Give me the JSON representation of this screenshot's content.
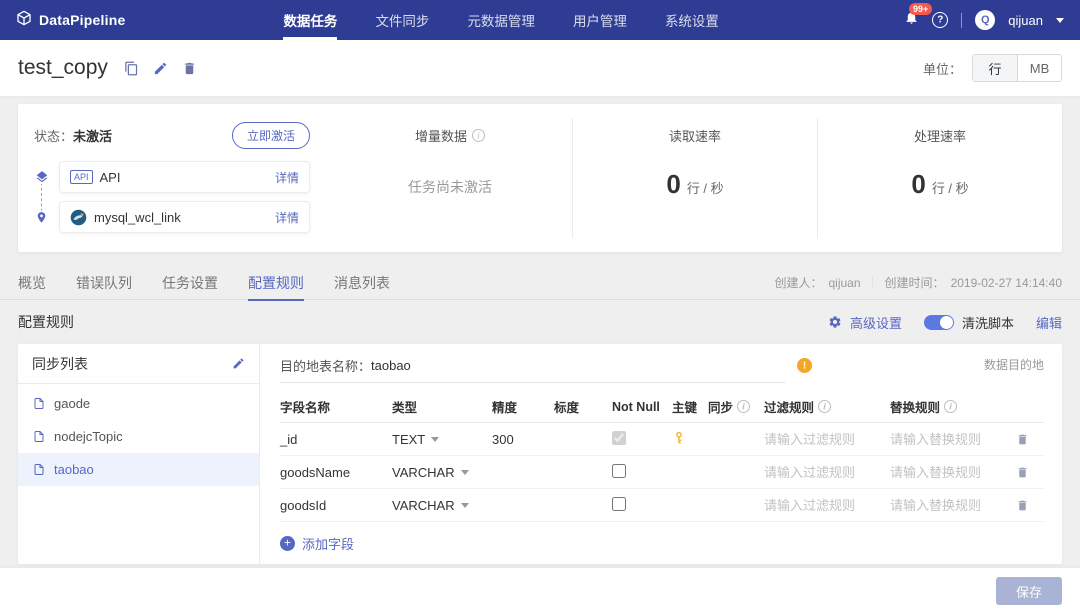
{
  "navbar": {
    "brand": "DataPipeline",
    "items": [
      {
        "label": "数据任务"
      },
      {
        "label": "文件同步"
      },
      {
        "label": "元数据管理"
      },
      {
        "label": "用户管理"
      },
      {
        "label": "系统设置"
      }
    ],
    "notification_badge": "99+",
    "avatar_letter": "Q",
    "user_name": "qijuan"
  },
  "header": {
    "title": "test_copy",
    "unit_label": "单位：",
    "unit_row": "行",
    "unit_mb": "MB"
  },
  "status": {
    "label": "状态：",
    "value": "未激活",
    "activate_button": "立即激活",
    "source_node": {
      "tag": "API",
      "name": "API",
      "detail_link": "详情"
    },
    "dest_node": {
      "name": "mysql_wcl_link",
      "detail_link": "详情"
    },
    "metrics": {
      "incremental": {
        "title": "增量数据",
        "value": "任务尚未激活"
      },
      "read": {
        "title": "读取速率",
        "value": "0",
        "unit": "行 / 秒"
      },
      "process": {
        "title": "处理速率",
        "value": "0",
        "unit": "行 / 秒"
      }
    }
  },
  "tabs": {
    "items": [
      "概览",
      "错误队列",
      "任务设置",
      "配置规则",
      "消息列表"
    ],
    "active": "配置规则",
    "creator_label": "创建人：",
    "creator_value": "qijuan",
    "divider": "｜",
    "created_label": "创建时间：",
    "created_value": "2019-02-27 14:14:40"
  },
  "config_bar": {
    "title": "配置规则",
    "advanced_settings": "高级设置",
    "clean_script": "清洗脚本",
    "edit": "编辑"
  },
  "sync_panel": {
    "title": "同步列表",
    "items": [
      {
        "name": "gaode",
        "selected": false
      },
      {
        "name": "nodejcTopic",
        "selected": false
      },
      {
        "name": "taobao",
        "selected": true
      }
    ]
  },
  "rules_panel": {
    "dest_label": "目的地表名称：",
    "dest_value": "taobao",
    "corner_hint": "数据目的地",
    "columns": [
      "字段名称",
      "类型",
      "精度",
      "标度",
      "Not Null",
      "主键",
      "同步",
      "过滤规则",
      "替换规则"
    ],
    "filter_placeholder": "请输入过滤规则",
    "replace_placeholder": "请输入替换规则",
    "rows": [
      {
        "field": "_id",
        "type": "TEXT",
        "precision": "300",
        "scale": "",
        "not_null": true,
        "primary_key": true,
        "sync": true
      },
      {
        "field": "goodsName",
        "type": "VARCHAR",
        "precision": "",
        "scale": "",
        "not_null": false,
        "primary_key": false,
        "sync": true
      },
      {
        "field": "goodsId",
        "type": "VARCHAR",
        "precision": "",
        "scale": "",
        "not_null": false,
        "primary_key": false,
        "sync": true
      }
    ],
    "add_field": "添加字段"
  },
  "footer": {
    "save_button": "保存"
  },
  "colors": {
    "navbar": "#2e3c94",
    "accent": "#5868c1",
    "toggle_on": "#5b79e0",
    "warning": "#f5a623",
    "key": "#f0b429"
  }
}
